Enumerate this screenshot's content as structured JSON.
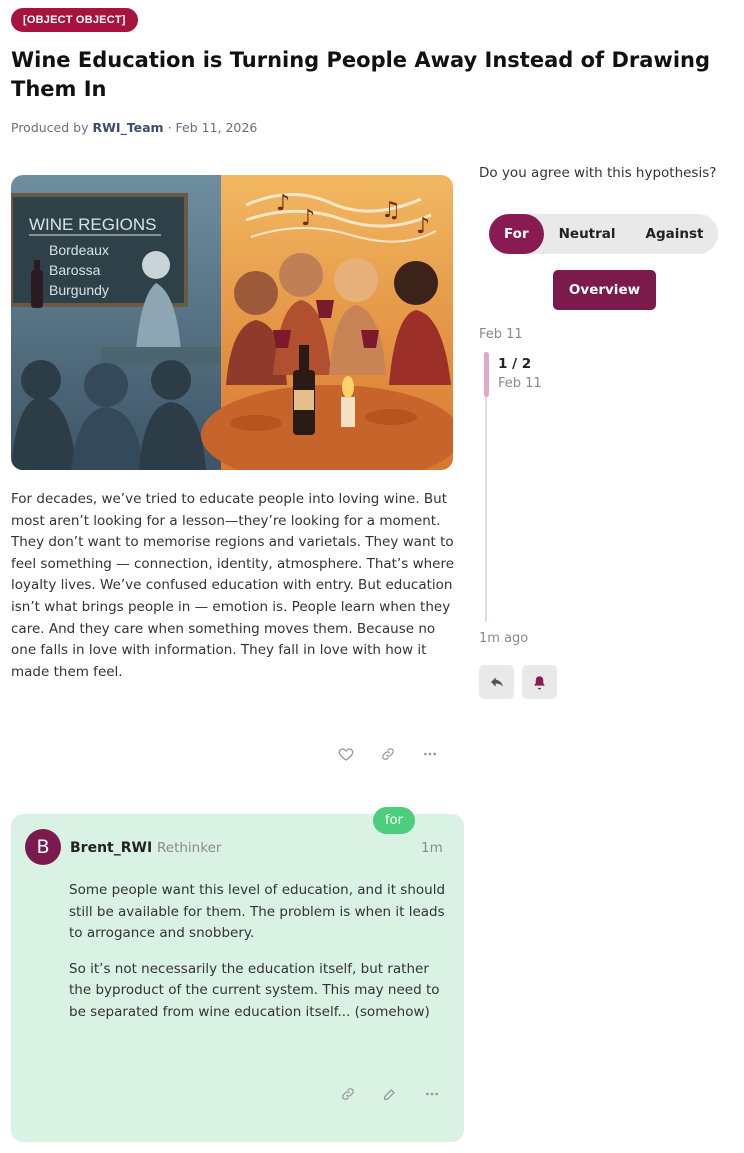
{
  "topic": {
    "tag": "[OBJECT OBJECT]",
    "title": "Wine Education is Turning People Away Instead of Drawing Them In",
    "byline_prefix": "Produced by ",
    "author": "RWI_Team",
    "date": " · Feb 11, 2026"
  },
  "hero_image": {
    "left_panel": {
      "board_title": "WINE REGIONS",
      "regions": [
        "Bordeaux",
        "Barossa",
        "Burgundy"
      ]
    }
  },
  "post": {
    "body": "For decades, we’ve tried to educate people into loving wine. But most aren’t looking for a lesson—they’re looking for a moment. They don’t want to memorise regions and varietals. They want to feel something — connection, identity, atmosphere. That’s where loyalty lives. We’ve confused education with entry. But education isn’t what brings people in — emotion is. People learn when they care. And they care when something moves them. Because no one falls in love with information. They fall in love with how it made them feel.",
    "actions": {
      "like": "heart-icon",
      "link": "link-icon",
      "more": "more-icon"
    }
  },
  "sidebar": {
    "question": "Do you agree with this hypothesis?",
    "votes": {
      "for": "For",
      "neutral": "Neutral",
      "against": "Against"
    },
    "overview": "Overview",
    "timeline": {
      "top_date": "Feb 11",
      "count": "1 / 2",
      "current_date": "Feb 11",
      "bottom": "1m ago"
    }
  },
  "comment": {
    "stance": "for",
    "avatar_letter": "B",
    "username": "Brent_RWI",
    "role": "Rethinker",
    "time": "1m",
    "paragraphs": [
      "Some people want this level of education, and it should still be available for them. The problem is when it leads to arrogance and snobbery.",
      "So it’s not necessarily the education itself, but rather the byproduct of the current system. This may need to be separated from wine education itself... (somehow)"
    ]
  },
  "colors": {
    "brand": "#7b1a4b",
    "tag": "#a8123e",
    "for": "#4cce7c",
    "comment_bg": "#daf2e3"
  }
}
